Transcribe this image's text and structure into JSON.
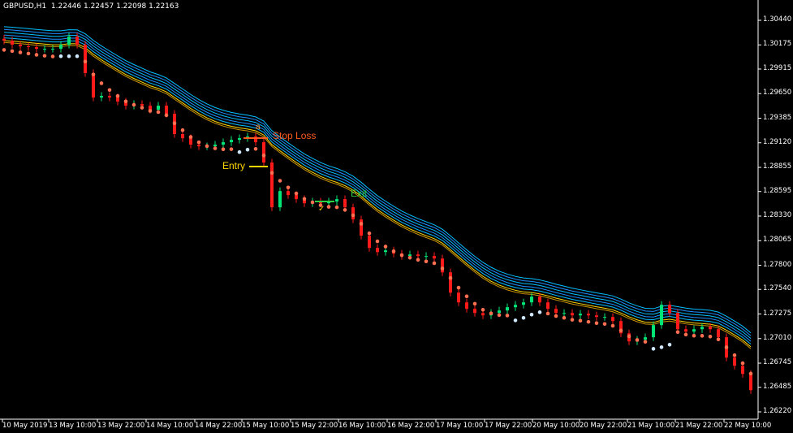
{
  "header": {
    "symbol": "GBPUSD,H1",
    "ohlc": "1.22446 1.22457 1.22098 1.22163"
  },
  "annotations": {
    "stop_loss": "Stop Loss",
    "entry": "Entry",
    "exit": "Exit",
    "marker": "a",
    "check": "✓"
  },
  "colors": {
    "bull": "#00e676",
    "bear": "#ff1a1a",
    "band": "#1e90ff",
    "band_light": "#00bfff",
    "ma": "#ffd700",
    "dots_down": "#ff7050",
    "dots_up": "#cfe8ff",
    "stop_loss": "#ff5a1f",
    "entry": "#ffd700",
    "exit": "#2ecc40",
    "axis": "#ffffff"
  },
  "chart_data": {
    "type": "candlestick",
    "title": "GBPUSD,H1",
    "ylim": [
      1.2622,
      1.3044
    ],
    "grid": false,
    "y_ticks": [
      "1.30440",
      "1.30175",
      "1.29915",
      "1.29650",
      "1.29385",
      "1.29120",
      "1.28855",
      "1.28595",
      "1.28330",
      "1.28065",
      "1.27800",
      "1.27540",
      "1.27275",
      "1.27010",
      "1.26745",
      "1.26485",
      "1.26220"
    ],
    "x_ticks": [
      "10 May 2019",
      "13 May 10:00",
      "13 May 22:00",
      "14 May 10:00",
      "14 May 22:00",
      "15 May 10:00",
      "15 May 22:00",
      "16 May 10:00",
      "16 May 22:00",
      "17 May 10:00",
      "17 May 22:00",
      "20 May 10:00",
      "20 May 22:00",
      "21 May 10:00",
      "21 May 22:00",
      "22 May 10:00"
    ],
    "closes": [
      1.30221,
      1.30177,
      1.3016,
      1.30151,
      1.30133,
      1.30133,
      1.30133,
      1.30177,
      1.30265,
      1.30177,
      1.29871,
      1.29608,
      1.29625,
      1.29608,
      1.29564,
      1.2952,
      1.29538,
      1.2952,
      1.29476,
      1.2952,
      1.29433,
      1.29214,
      1.2917,
      1.291,
      1.29082,
      1.29082,
      1.291,
      1.29126,
      1.29152,
      1.2917,
      1.29187,
      1.29126,
      1.28907,
      1.28425,
      1.286,
      1.28557,
      1.28513,
      1.28469,
      1.28487,
      1.28469,
      1.28487,
      1.28513,
      1.28425,
      1.28294,
      1.28119,
      1.27987,
      1.27943,
      1.27961,
      1.27926,
      1.279,
      1.27917,
      1.279,
      1.279,
      1.27873,
      1.27724,
      1.27505,
      1.274,
      1.2733,
      1.27286,
      1.2726,
      1.27286,
      1.27313,
      1.27348,
      1.27374,
      1.274,
      1.27462,
      1.274,
      1.2733,
      1.27286,
      1.27286,
      1.2726,
      1.27278,
      1.2726,
      1.27243,
      1.27243,
      1.27199,
      1.27067,
      1.2698,
      1.26997,
      1.27024,
      1.27155,
      1.27374,
      1.27286,
      1.27111,
      1.27085,
      1.27111,
      1.27137,
      1.27111,
      1.27024,
      1.26805,
      1.26717,
      1.26629,
      1.26454
    ]
  }
}
